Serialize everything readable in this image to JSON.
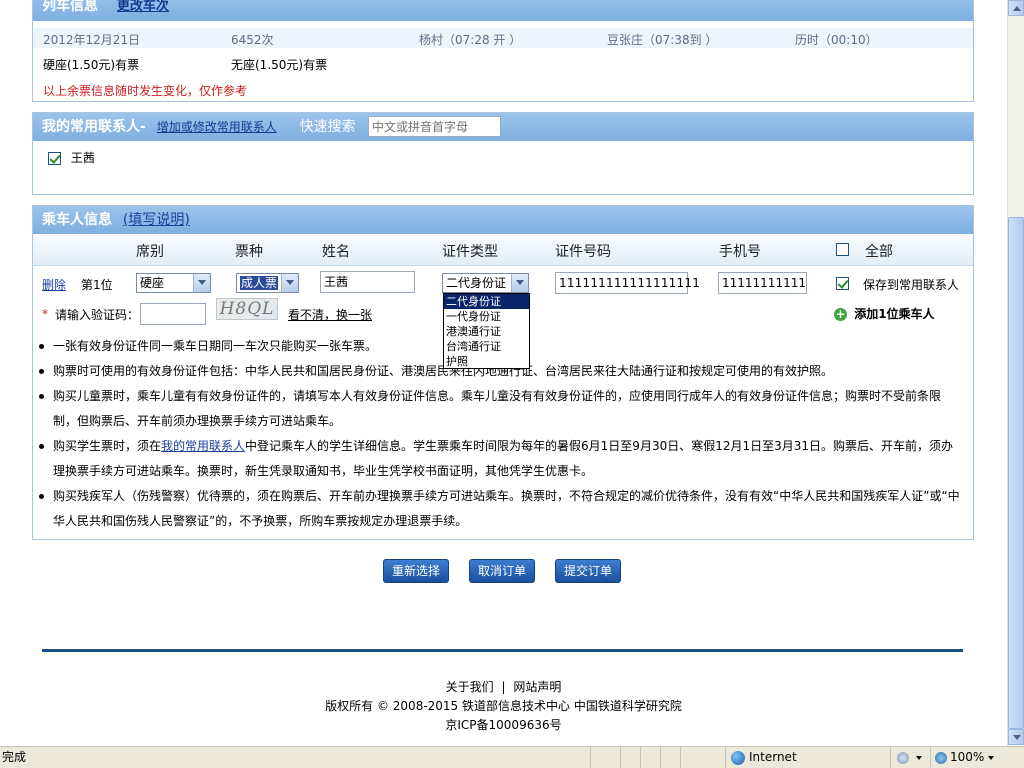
{
  "train": {
    "title": "列车信息",
    "change_link": "更改车次",
    "date": "2012年12月21日",
    "number": "6452次",
    "depart": "杨村（07:28  开  ）",
    "arrive": "豆张庄（07:38到  ）",
    "duration": "历时（00:10）",
    "seat_hard": "硬座(1.50元)有票",
    "seat_none": "无座(1.50元)有票",
    "warning": "以上余票信息随时发生变化，仅作参考"
  },
  "contacts": {
    "title": "我的常用联系人",
    "separator": "-",
    "manage_link": "增加或修改常用联系人",
    "quick_search_label": "快速搜索",
    "search_placeholder": "中文或拼音首字母",
    "items": [
      {
        "name": "王茜",
        "checked": true
      }
    ]
  },
  "passenger": {
    "title": "乘车人信息",
    "help_link": "(填写说明)",
    "columns": {
      "seat": "席别",
      "ticket": "票种",
      "name": "姓名",
      "id_type": "证件类型",
      "id_no": "证件号码",
      "phone": "手机号",
      "all": "全部"
    },
    "row": {
      "delete": "删除",
      "position": "第1位",
      "seat": "硬座",
      "ticket_type": "成人票",
      "name": "王茜",
      "id_type": "二代身份证",
      "id_number": "111111111111111111",
      "phone": "11111111111",
      "save_label": "保存到常用联系人"
    },
    "id_type_options": [
      "二代身份证",
      "一代身份证",
      "港澳通行证",
      "台湾通行证",
      "护照"
    ],
    "captcha": {
      "required_mark": "*",
      "label": "请输入验证码：",
      "image_text": "H8QL",
      "refresh_link": "看不清，换一张"
    },
    "add_passenger": "添加1位乘车人"
  },
  "notes": [
    {
      "text": "一张有效身份证件同一乘车日期同一车次只能购买一张车票。"
    },
    {
      "text": "购票时可使用的有效身份证件包括：中华人民共和国居民身份证、港澳居民来往内地通行证、台湾居民来往大陆通行证和按规定可使用的有效护照。"
    },
    {
      "text": "购买儿童票时，乘车儿童有有效身份证件的，请填写本人有效身份证件信息。乘车儿童没有有效身份证件的，应使用同行成年人的有效身份证件信息；购票时不受前条限制，但购票后、开车前须办理换票手续方可进站乘车。"
    },
    {
      "pre": "购买学生票时，须在",
      "link": "我的常用联系人",
      "post": "中登记乘车人的学生详细信息。学生票乘车时间限为每年的暑假6月1日至9月30日、寒假12月1日至3月31日。购票后、开车前，须办理换票手续方可进站乘车。换票时，新生凭录取通知书，毕业生凭学校书面证明，其他凭学生优惠卡。"
    },
    {
      "text": "购买残疾军人（伤残警察）优待票的，须在购票后、开车前办理换票手续方可进站乘车。换票时，不符合规定的减价优待条件，没有有效“中华人民共和国残疾军人证”或“中华人民共和国伤残人民警察证”的，不予换票，所购车票按规定办理退票手续。"
    }
  ],
  "buttons": {
    "reselect": "重新选择",
    "cancel": "取消订单",
    "submit": "提交订单"
  },
  "footer": {
    "about": "关于我们",
    "divider": "|",
    "statement": "网站声明",
    "copyright": "版权所有  ©  2008-2015 铁道部信息技术中心  中国铁道科学研究院",
    "icp": "京ICP备10009636号"
  },
  "statusbar": {
    "status": "完成",
    "zone": "Internet",
    "zoom": "100%"
  },
  "colors": {
    "panel_header": "#8ab8e6",
    "accent_link": "#1a3f9c",
    "warning": "#cc1e1e",
    "button": "#2a63b8"
  },
  "icons": [
    "checkbox-checked",
    "dropdown-arrow",
    "add-plus-icon",
    "globe-icon",
    "zoom-icon"
  ]
}
